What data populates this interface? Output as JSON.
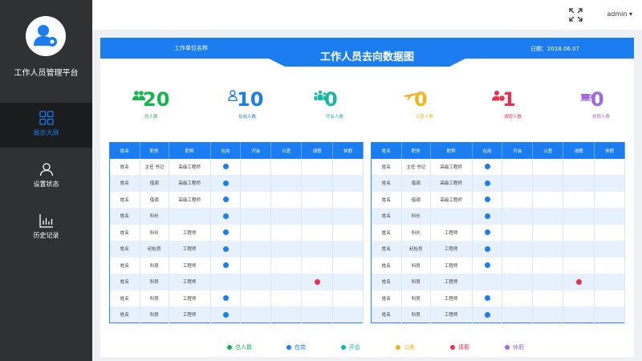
{
  "sidebar": {
    "app_title": "工作人员管理平台",
    "nav": [
      {
        "label": "展示大屏",
        "icon": "grid-icon",
        "active": true
      },
      {
        "label": "设置状态",
        "icon": "user-icon",
        "active": false
      },
      {
        "label": "历史记录",
        "icon": "bar-chart-icon",
        "active": false
      }
    ]
  },
  "topbar": {
    "fullscreen_icon": "fullscreen-icon",
    "user": "admin ▾"
  },
  "header": {
    "unit_name": "工作单位名称",
    "title": "工作人员去向数据图",
    "date": "日期：2018.06.07"
  },
  "stats": [
    {
      "value": "20",
      "label": "总人数",
      "color": "#16b34f",
      "icon": "group-icon"
    },
    {
      "value": "10",
      "label": "在岗人数",
      "color": "#1b7df0",
      "icon": "person-icon"
    },
    {
      "value": "0",
      "label": "开会人数",
      "color": "#16b8a3",
      "icon": "meeting-icon"
    },
    {
      "value": "0",
      "label": "公差人数",
      "color": "#f4b21b",
      "icon": "plane-icon"
    },
    {
      "value": "1",
      "label": "请假人数",
      "color": "#e8304f",
      "icon": "leave-icon"
    },
    {
      "value": "0",
      "label": "休假人数",
      "color": "#a067e0",
      "icon": "coffee-icon"
    }
  ],
  "table": {
    "headers": [
      "姓名",
      "职务",
      "职称",
      "在岗",
      "开会",
      "公差",
      "请假",
      "休假"
    ],
    "left": [
      {
        "name": "姓名",
        "post": "主任  书记",
        "title": "高级工程师",
        "status": "在岗"
      },
      {
        "name": "姓名",
        "post": "借调",
        "title": "高级工程师",
        "status": "在岗"
      },
      {
        "name": "姓名",
        "post": "借调",
        "title": "高级工程师",
        "status": "在岗"
      },
      {
        "name": "姓名",
        "post": "科长",
        "title": "",
        "status": "在岗"
      },
      {
        "name": "姓名",
        "post": "科长",
        "title": "工程师",
        "status": "在岗"
      },
      {
        "name": "姓名",
        "post": "纪检员",
        "title": "工程师",
        "status": "在岗"
      },
      {
        "name": "姓名",
        "post": "科员",
        "title": "工程师",
        "status": "在岗"
      },
      {
        "name": "姓名",
        "post": "科员",
        "title": "工程师",
        "status": "请假"
      },
      {
        "name": "姓名",
        "post": "科员",
        "title": "工程师",
        "status": "在岗"
      },
      {
        "name": "姓名",
        "post": "科员",
        "title": "工程师",
        "status": "在岗"
      }
    ],
    "right": [
      {
        "name": "姓名",
        "post": "主任  书记",
        "title": "高级工程师",
        "status": "在岗"
      },
      {
        "name": "姓名",
        "post": "借调",
        "title": "高级工程师",
        "status": "在岗"
      },
      {
        "name": "姓名",
        "post": "借调",
        "title": "高级工程师",
        "status": "在岗"
      },
      {
        "name": "姓名",
        "post": "科长",
        "title": "",
        "status": "在岗"
      },
      {
        "name": "姓名",
        "post": "科长",
        "title": "工程师",
        "status": "在岗"
      },
      {
        "name": "姓名",
        "post": "纪检员",
        "title": "工程师",
        "status": "在岗"
      },
      {
        "name": "姓名",
        "post": "科员",
        "title": "工程师",
        "status": "在岗"
      },
      {
        "name": "姓名",
        "post": "科员",
        "title": "工程师",
        "status": "请假"
      },
      {
        "name": "姓名",
        "post": "科员",
        "title": "工程师",
        "status": "在岗"
      },
      {
        "name": "姓名",
        "post": "科员",
        "title": "工程师",
        "status": "在岗"
      }
    ]
  },
  "legend": [
    {
      "label": "总人数",
      "color": "#16b34f"
    },
    {
      "label": "在岗",
      "color": "#1b7df0"
    },
    {
      "label": "开会",
      "color": "#16b8a3"
    },
    {
      "label": "公差",
      "color": "#f4b21b"
    },
    {
      "label": "请假",
      "color": "#e8304f"
    },
    {
      "label": "休假",
      "color": "#a067e0"
    }
  ],
  "status_colors": {
    "在岗": "#1b7df0",
    "开会": "#16b8a3",
    "公差": "#f4b21b",
    "请假": "#e8304f",
    "休假": "#a067e0"
  }
}
